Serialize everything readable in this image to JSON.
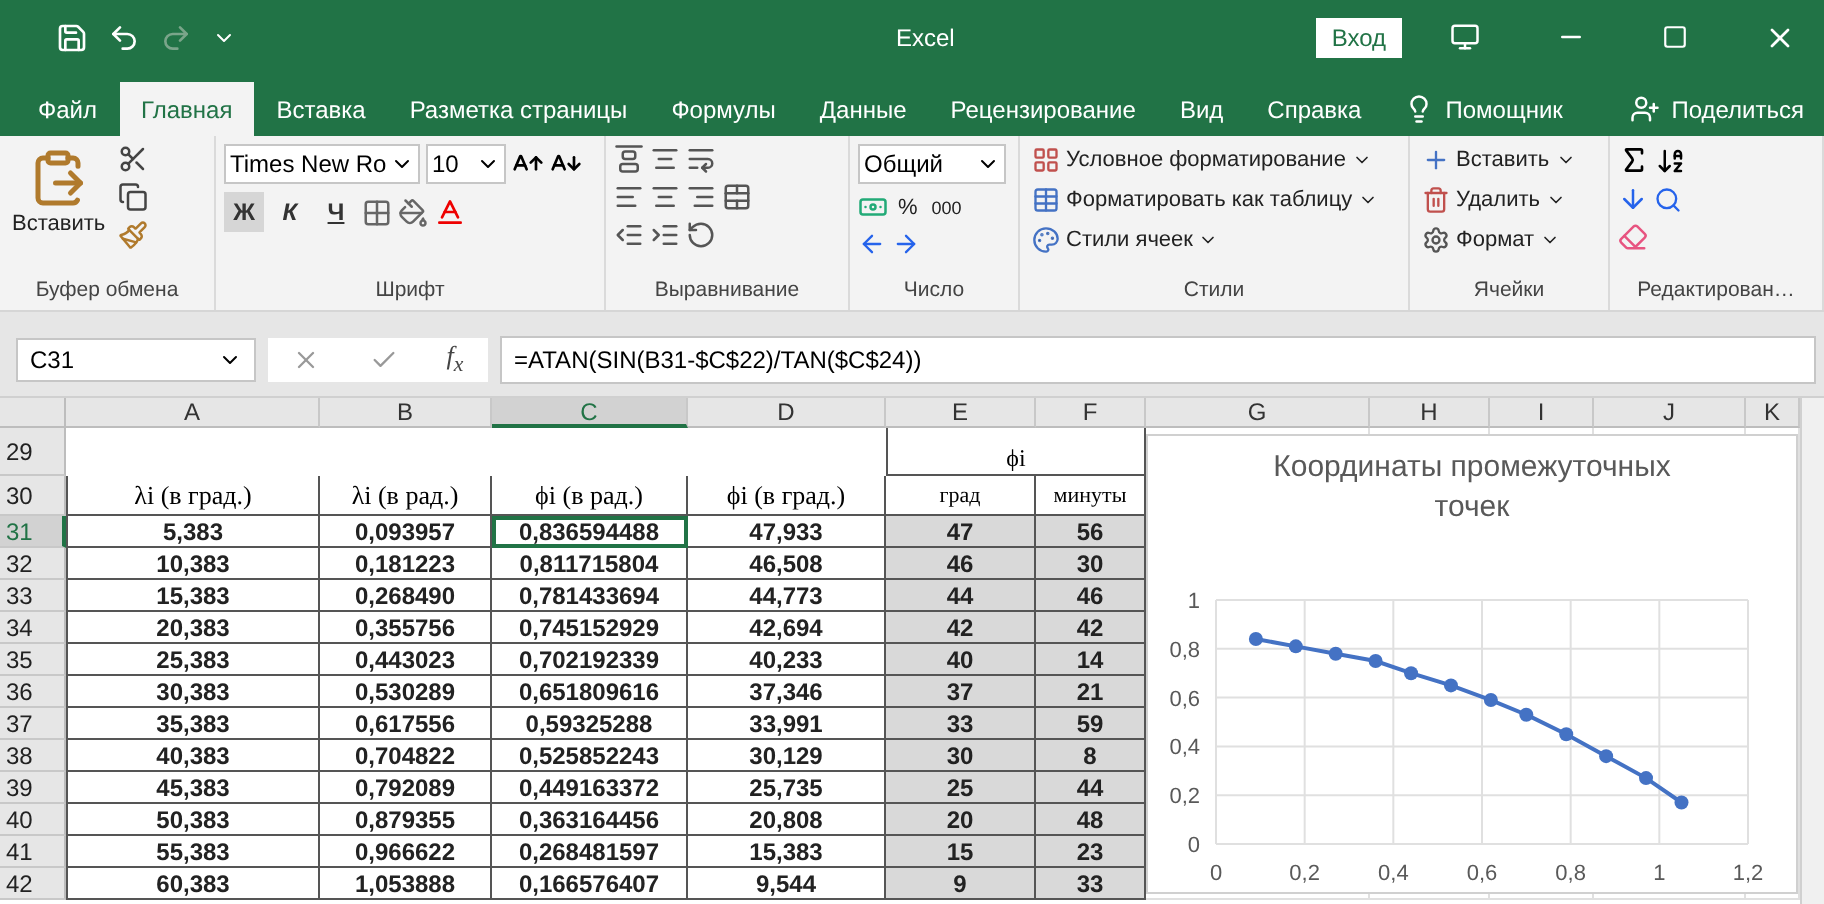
{
  "window": {
    "title": "Excel",
    "sign_in": "Вход"
  },
  "ribbon_tabs": [
    {
      "label": "Файл",
      "selected": false
    },
    {
      "label": "Главная",
      "selected": true
    },
    {
      "label": "Вставка",
      "selected": false
    },
    {
      "label": "Разметка страницы",
      "selected": false
    },
    {
      "label": "Формулы",
      "selected": false
    },
    {
      "label": "Данные",
      "selected": false
    },
    {
      "label": "Рецензирование",
      "selected": false
    },
    {
      "label": "Вид",
      "selected": false
    },
    {
      "label": "Справка",
      "selected": false
    }
  ],
  "tell_me": "Помощник",
  "share": "Поделиться",
  "clipboard": {
    "paste": "Вставить",
    "label": "Буфер обмена"
  },
  "font": {
    "name": "Times New Ro",
    "size": "10",
    "bold": "Ж",
    "italic": "К",
    "underline": "Ч",
    "label": "Шрифт"
  },
  "alignment": {
    "label": "Выравнивание"
  },
  "number": {
    "format": "Общий",
    "percent": "%",
    "thousands": "000",
    "label": "Число"
  },
  "styles": {
    "items": [
      "Условное форматирование",
      "Форматировать как таблицу",
      "Стили ячеек"
    ],
    "label": "Стили"
  },
  "cells": {
    "items": [
      "Вставить",
      "Удалить",
      "Формат"
    ],
    "label": "Ячейки"
  },
  "editing": {
    "label": "Редактирован…"
  },
  "formula_bar": {
    "name_box": "C31",
    "fx": "f$_{x}$",
    "formula": "=ATAN(SIN(B31-$C$22)/TAN($C$24))"
  },
  "sheet": {
    "columns": [
      {
        "label": "A",
        "selected": false
      },
      {
        "label": "B",
        "selected": false
      },
      {
        "label": "C",
        "selected": true
      },
      {
        "label": "D",
        "selected": false
      },
      {
        "label": "E",
        "selected": false
      },
      {
        "label": "F",
        "selected": false
      },
      {
        "label": "G",
        "selected": false
      },
      {
        "label": "H",
        "selected": false
      },
      {
        "label": "I",
        "selected": false
      },
      {
        "label": "J",
        "selected": false
      },
      {
        "label": "K",
        "selected": false
      }
    ],
    "group_row": {
      "number": "29",
      "label": "ϕi"
    },
    "header_row": {
      "number": "30",
      "cells": [
        "λi (в град.)",
        "λi (в рад.)",
        "ϕi (в рад.)",
        "ϕi (в град.)",
        "град",
        "минуты"
      ]
    },
    "rows": [
      {
        "number": "31",
        "selected": true,
        "cells": [
          "5,383",
          "0,093957",
          "0,836594488",
          "47,933",
          "47",
          "56"
        ]
      },
      {
        "number": "32",
        "selected": false,
        "cells": [
          "10,383",
          "0,181223",
          "0,811715804",
          "46,508",
          "46",
          "30"
        ]
      },
      {
        "number": "33",
        "selected": false,
        "cells": [
          "15,383",
          "0,268490",
          "0,781433694",
          "44,773",
          "44",
          "46"
        ]
      },
      {
        "number": "34",
        "selected": false,
        "cells": [
          "20,383",
          "0,355756",
          "0,745152929",
          "42,694",
          "42",
          "42"
        ]
      },
      {
        "number": "35",
        "selected": false,
        "cells": [
          "25,383",
          "0,443023",
          "0,702192339",
          "40,233",
          "40",
          "14"
        ]
      },
      {
        "number": "36",
        "selected": false,
        "cells": [
          "30,383",
          "0,530289",
          "0,651809616",
          "37,346",
          "37",
          "21"
        ]
      },
      {
        "number": "37",
        "selected": false,
        "cells": [
          "35,383",
          "0,617556",
          "0,59325288",
          "33,991",
          "33",
          "59"
        ]
      },
      {
        "number": "38",
        "selected": false,
        "cells": [
          "40,383",
          "0,704822",
          "0,525852243",
          "30,129",
          "30",
          "8"
        ]
      },
      {
        "number": "39",
        "selected": false,
        "cells": [
          "45,383",
          "0,792089",
          "0,449163372",
          "25,735",
          "25",
          "44"
        ]
      },
      {
        "number": "40",
        "selected": false,
        "cells": [
          "50,383",
          "0,879355",
          "0,363164456",
          "20,808",
          "20",
          "48"
        ]
      },
      {
        "number": "41",
        "selected": false,
        "cells": [
          "55,383",
          "0,966622",
          "0,268481597",
          "15,383",
          "15",
          "23"
        ]
      },
      {
        "number": "42",
        "selected": false,
        "cells": [
          "60,383",
          "1,053888",
          "0,166576407",
          "9,544",
          "9",
          "33"
        ]
      }
    ]
  },
  "chart": {
    "chart_data": {
      "type": "line",
      "title": "Координаты промежуточных точек",
      "x": [
        0.09,
        0.18,
        0.27,
        0.36,
        0.44,
        0.53,
        0.62,
        0.7,
        0.79,
        0.88,
        0.97,
        1.05
      ],
      "series": [
        {
          "color": "#4472c4",
          "marker": true,
          "values": [
            0.84,
            0.81,
            0.78,
            0.75,
            0.7,
            0.65,
            0.59,
            0.53,
            0.45,
            0.36,
            0.27,
            0.17
          ]
        }
      ],
      "grid": true,
      "xlim": [
        0,
        1.2
      ],
      "ylim": [
        0,
        1
      ],
      "xticks": [
        {
          "value": 0,
          "label": "0"
        },
        {
          "value": 0.2,
          "label": "0,2"
        },
        {
          "value": 0.4,
          "label": "0,4"
        },
        {
          "value": 0.6,
          "label": "0,6"
        },
        {
          "value": 0.8,
          "label": "0,8"
        },
        {
          "value": 1,
          "label": "1"
        },
        {
          "value": 1.2,
          "label": "1,2"
        }
      ],
      "yticks": [
        {
          "value": 0,
          "label": "0"
        },
        {
          "value": 0.2,
          "label": "0,2"
        },
        {
          "value": 0.4,
          "label": "0,4"
        },
        {
          "value": 0.6,
          "label": "0,6"
        },
        {
          "value": 0.8,
          "label": "0,8"
        },
        {
          "value": 1,
          "label": "1"
        }
      ]
    }
  }
}
